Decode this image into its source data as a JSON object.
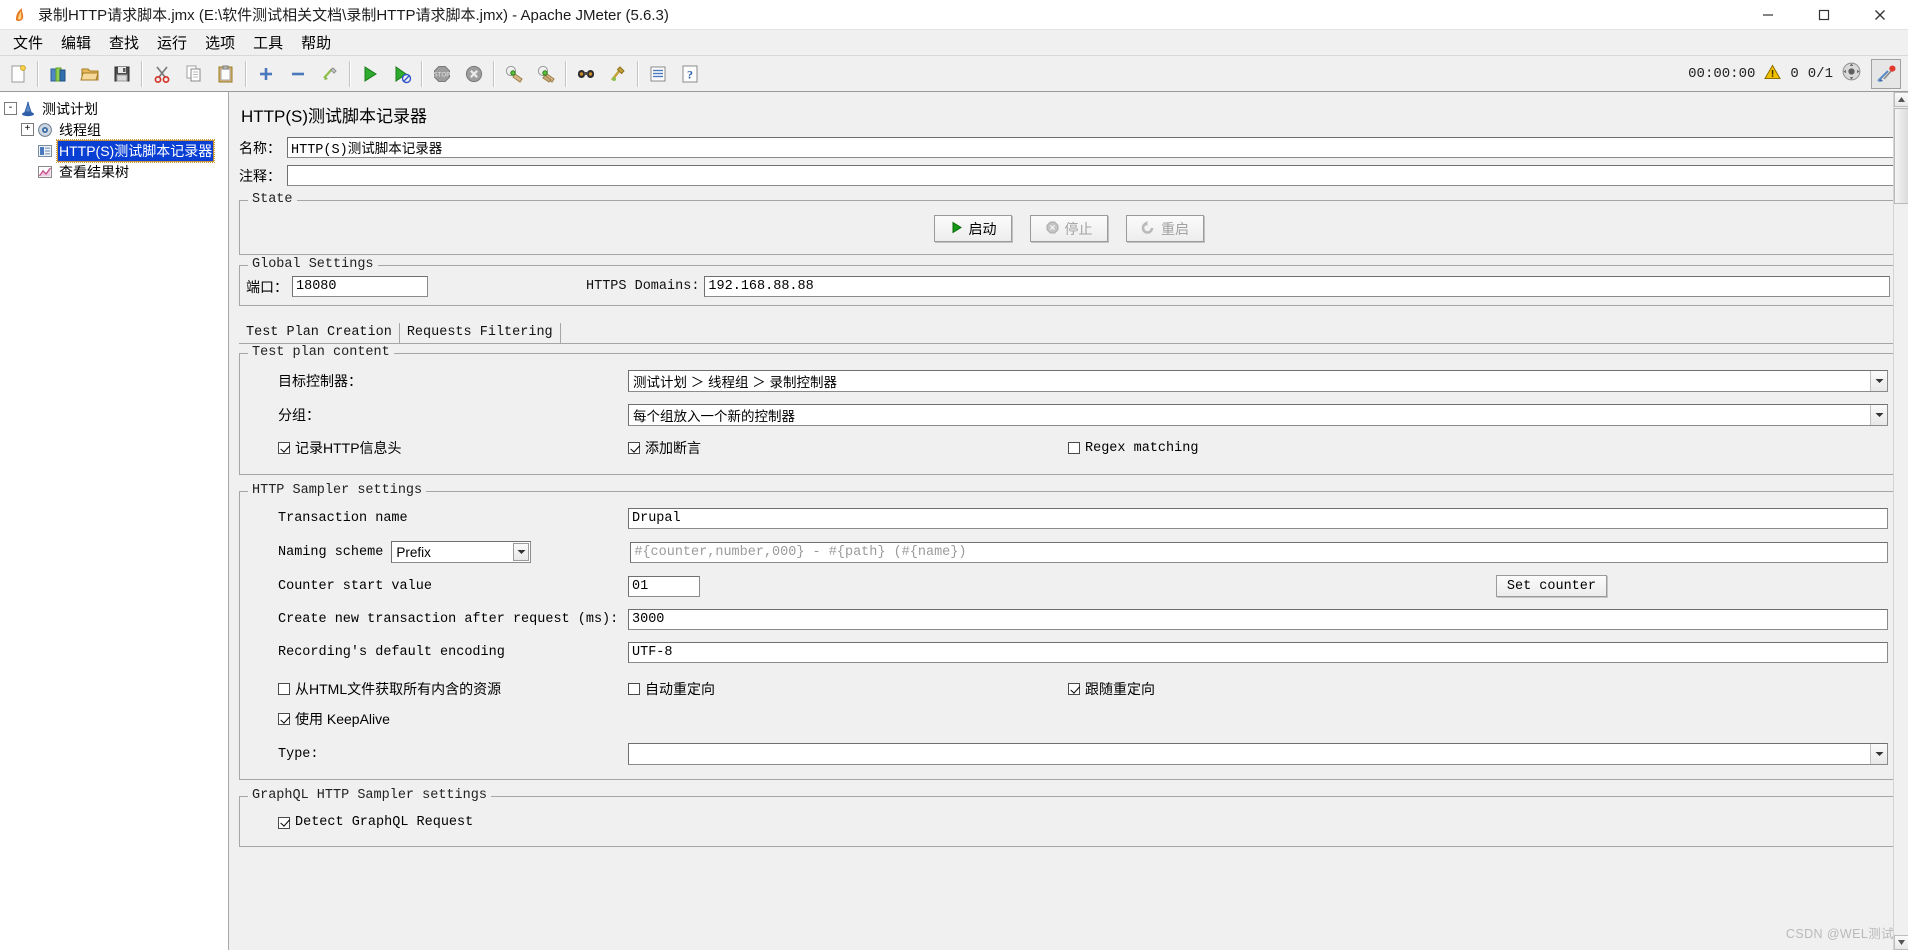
{
  "window": {
    "title": "录制HTTP请求脚本.jmx (E:\\软件测试相关文档\\录制HTTP请求脚本.jmx) - Apache JMeter (5.6.3)",
    "app_icon": "jmeter-icon",
    "minimize": "—",
    "maximize": "□",
    "close": "✕"
  },
  "menu": {
    "items": [
      {
        "label": "文件",
        "name": "menu-file"
      },
      {
        "label": "编辑",
        "name": "menu-edit"
      },
      {
        "label": "查找",
        "name": "menu-search"
      },
      {
        "label": "运行",
        "name": "menu-run"
      },
      {
        "label": "选项",
        "name": "menu-options"
      },
      {
        "label": "工具",
        "name": "menu-tools"
      },
      {
        "label": "帮助",
        "name": "menu-help"
      }
    ]
  },
  "toolbar": {
    "buttons": [
      {
        "icon": "new-icon",
        "name": "toolbar-new"
      },
      {
        "icon": "templates-icon",
        "name": "toolbar-templates"
      },
      {
        "icon": "open-icon",
        "name": "toolbar-open"
      },
      {
        "icon": "save-icon",
        "name": "toolbar-save"
      },
      {
        "icon": "cut-icon",
        "name": "toolbar-cut"
      },
      {
        "icon": "copy-icon",
        "name": "toolbar-copy"
      },
      {
        "icon": "paste-icon",
        "name": "toolbar-paste"
      },
      {
        "icon": "expand-icon",
        "name": "toolbar-expand-all"
      },
      {
        "icon": "collapse-icon",
        "name": "toolbar-collapse-all"
      },
      {
        "icon": "toggle-icon",
        "name": "toolbar-toggle"
      },
      {
        "icon": "start-icon",
        "name": "toolbar-start"
      },
      {
        "icon": "start-no-pauses-icon",
        "name": "toolbar-start-no-pauses"
      },
      {
        "icon": "stop-icon",
        "name": "toolbar-stop"
      },
      {
        "icon": "shutdown-icon",
        "name": "toolbar-shutdown"
      },
      {
        "icon": "clear-icon",
        "name": "toolbar-clear"
      },
      {
        "icon": "clear-all-icon",
        "name": "toolbar-clear-all"
      },
      {
        "icon": "search-icon",
        "name": "toolbar-search"
      },
      {
        "icon": "search-reset-icon",
        "name": "toolbar-search-reset"
      },
      {
        "icon": "function-helper-icon",
        "name": "toolbar-function-helper"
      },
      {
        "icon": "help-icon",
        "name": "toolbar-help"
      }
    ],
    "status": {
      "elapsed": "00:00:00",
      "warning_icon": "warning-triangle-icon",
      "warning_count": "0",
      "threads": "0/1",
      "dashboard_icon": "dashboard-icon",
      "recorder_icon": "recorder-icon"
    }
  },
  "tree": {
    "items": [
      {
        "label": "测试计划",
        "icon": "test-plan-icon",
        "expander": "-",
        "depth": 0,
        "selected": false,
        "name": "tree-item-test-plan"
      },
      {
        "label": "线程组",
        "icon": "thread-group-icon",
        "expander": "+",
        "depth": 1,
        "selected": false,
        "name": "tree-item-thread-group"
      },
      {
        "label": "HTTP(S)测试脚本记录器",
        "icon": "recorder-element-icon",
        "expander": "",
        "depth": 1,
        "selected": true,
        "name": "tree-item-http-recorder"
      },
      {
        "label": "查看结果树",
        "icon": "view-results-tree-icon",
        "expander": "",
        "depth": 1,
        "selected": false,
        "name": "tree-item-view-results-tree"
      }
    ]
  },
  "editor": {
    "panel_title": "HTTP(S)测试脚本记录器",
    "name_label": "名称：",
    "name_value": "HTTP(S)测试脚本记录器",
    "comment_label": "注释：",
    "comment_value": "",
    "state": {
      "group_title": "State",
      "start_label": "启动",
      "stop_label": "停止",
      "restart_label": "重启",
      "start_icon": "play-icon",
      "stop_icon": "stop-octagon-icon",
      "restart_icon": "restart-arrow-icon"
    },
    "global_settings": {
      "group_title": "Global Settings",
      "port_label": "端口：",
      "port_value": "18080",
      "https_domains_label": "HTTPS Domains:",
      "https_domains_value": "192.168.88.88"
    },
    "tabs": [
      {
        "label": "Test Plan Creation",
        "active": true,
        "name": "tab-test-plan-creation"
      },
      {
        "label": "Requests Filtering",
        "active": false,
        "name": "tab-requests-filtering"
      }
    ],
    "test_plan_content": {
      "group_title": "Test plan content",
      "target_controller_label": "目标控制器：",
      "target_controller_value": "测试计划 ＞ 线程组 ＞ 录制控制器",
      "grouping_label": "分组：",
      "grouping_value": "每个组放入一个新的控制器",
      "capture_headers_label": "记录HTTP信息头",
      "capture_headers_checked": true,
      "add_assertions_label": "添加断言",
      "add_assertions_checked": true,
      "regex_matching_label": "Regex matching",
      "regex_matching_checked": false
    },
    "http_sampler_settings": {
      "group_title": "HTTP Sampler settings",
      "transaction_name_label": "Transaction name",
      "transaction_name_value": "Drupal",
      "naming_scheme_label": "Naming scheme",
      "naming_scheme_value": "Prefix",
      "naming_pattern_placeholder": "#{counter,number,000} - #{path} (#{name})",
      "counter_start_label": "Counter start value",
      "counter_start_value": "01",
      "set_counter_label": "Set counter",
      "new_transaction_label": "Create new transaction after request (ms):",
      "new_transaction_value": "3000",
      "encoding_label": "Recording's default encoding",
      "encoding_value": "UTF-8",
      "retrieve_embedded_label": "从HTML文件获取所有内含的资源",
      "retrieve_embedded_checked": false,
      "auto_redirect_label": "自动重定向",
      "auto_redirect_checked": false,
      "follow_redirect_label": "跟随重定向",
      "follow_redirect_checked": true,
      "use_keepalive_label": "使用 KeepAlive",
      "use_keepalive_checked": true,
      "type_label": "Type:",
      "type_value": ""
    },
    "graphql_settings": {
      "group_title": "GraphQL HTTP Sampler settings",
      "detect_graphql_label": "Detect GraphQL Request",
      "detect_graphql_checked": true
    }
  },
  "watermark": "CSDN @WEL测试",
  "colors": {
    "selection_blue": "#0a3fd4",
    "panel_bg": "#f0f0f0",
    "field_bg": "#ffffff",
    "border": "#a6a6a6",
    "start_green": "#118811",
    "warning_yellow": "#f2c200"
  }
}
